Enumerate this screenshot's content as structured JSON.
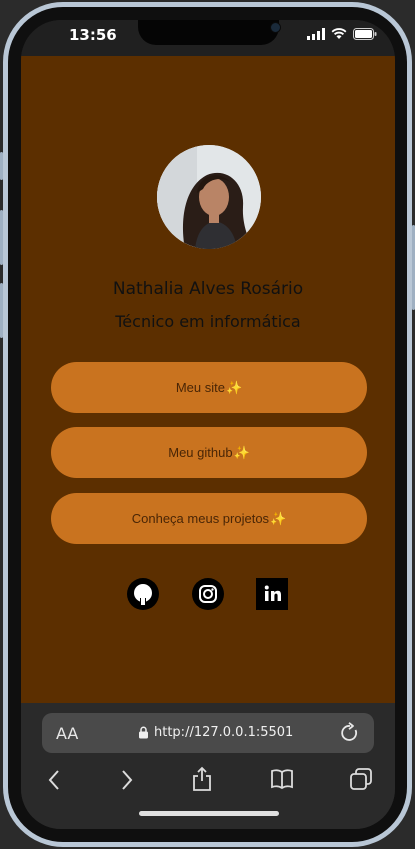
{
  "status_bar": {
    "time": "13:56"
  },
  "profile": {
    "name": "Nathalia Alves Rosário",
    "role": "Técnico em informática"
  },
  "links": [
    {
      "label": "Meu site",
      "icon": "sparkles-icon"
    },
    {
      "label": "Meu github",
      "icon": "sparkles-icon"
    },
    {
      "label": "Conheça meus projetos",
      "icon": "sparkles-icon"
    }
  ],
  "social": [
    "github-icon",
    "instagram-icon",
    "linkedin-icon"
  ],
  "browser": {
    "text_size_label": "AA",
    "url": "http://127.0.0.1:5501"
  },
  "colors": {
    "page_background": "#5c2f00",
    "button_background": "#c9731f",
    "button_text": "#4a2606"
  }
}
